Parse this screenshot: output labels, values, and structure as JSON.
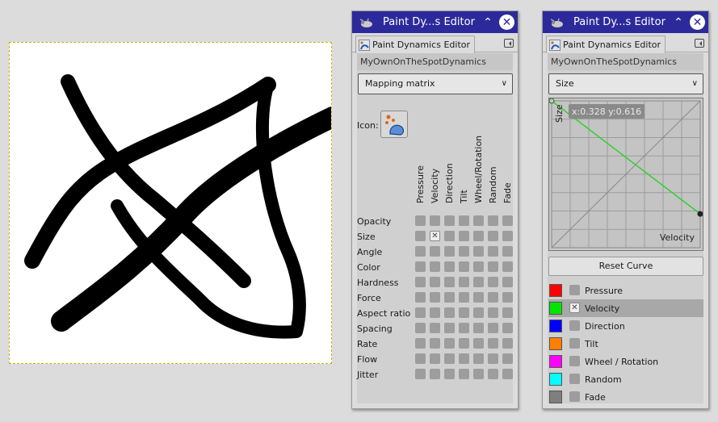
{
  "canvas": {
    "strokes": [
      "M72,48 C100,110 135,160 180,195 C215,225 250,255 290,295",
      "M28,270 C60,210 80,180 120,155 C175,120 240,105 320,52",
      "M318,58 C305,110 318,200 345,260 C360,295 362,330 355,358 C300,362 260,345 235,318 C195,280 160,250 133,202",
      "M64,345 C110,310 160,275 215,215 C250,175 320,130 400,92"
    ]
  },
  "win1": {
    "title": "Paint Dy...s Editor",
    "tab_label": "Paint Dynamics Editor",
    "dynamics_name": "MyOwnOnTheSpotDynamics",
    "mode_value": "Mapping matrix",
    "icon_label": "Icon:",
    "columns": [
      "Pressure",
      "Velocity",
      "Direction",
      "Tilt",
      "Wheel/Rotation",
      "Random",
      "Fade"
    ],
    "rows": [
      "Opacity",
      "Size",
      "Angle",
      "Color",
      "Hardness",
      "Force",
      "Aspect ratio",
      "Spacing",
      "Rate",
      "Flow",
      "Jitter"
    ],
    "checked_cell": "Size×Velocity",
    "check_glyph": "✕"
  },
  "win2": {
    "title": "Paint Dy...s Editor",
    "tab_label": "Paint Dynamics Editor",
    "dynamics_name": "MyOwnOnTheSpotDynamics",
    "output_value": "Size",
    "curve_ylabel": "Size",
    "curve_xlabel": "Velocity",
    "cursor_readout": "x:0.328 y:0.616",
    "curve_points": [
      [
        0.0,
        1.0
      ],
      [
        1.0,
        0.23
      ]
    ],
    "reset_label": "Reset Curve",
    "inputs": [
      {
        "label": "Pressure",
        "color": "#ff0000",
        "checked": false
      },
      {
        "label": "Velocity",
        "color": "#00e600",
        "checked": true
      },
      {
        "label": "Direction",
        "color": "#0000ff",
        "checked": false
      },
      {
        "label": "Tilt",
        "color": "#ff7f00",
        "checked": false
      },
      {
        "label": "Wheel / Rotation",
        "color": "#ff00ff",
        "checked": false
      },
      {
        "label": "Random",
        "color": "#00ffff",
        "checked": false
      },
      {
        "label": "Fade",
        "color": "#7f7f7f",
        "checked": false
      }
    ]
  }
}
